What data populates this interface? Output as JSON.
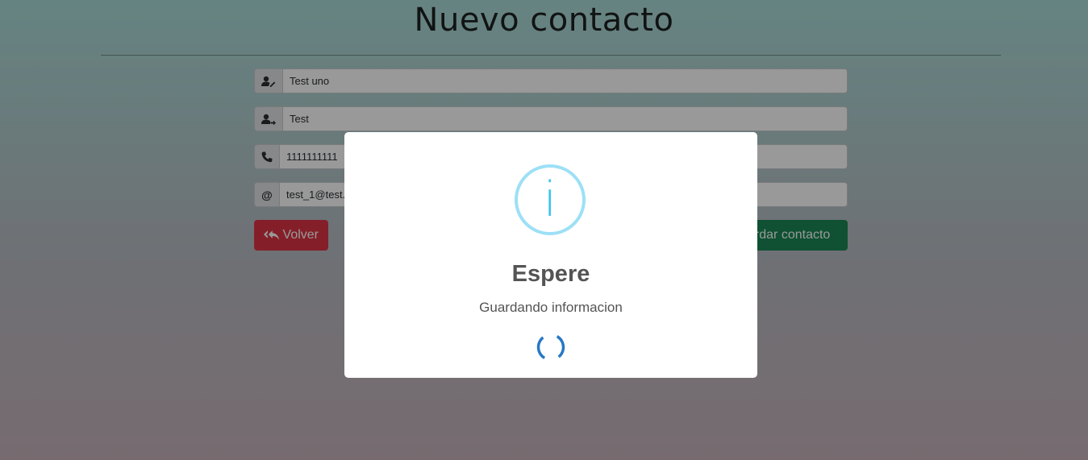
{
  "page": {
    "title": "Nuevo contacto"
  },
  "form": {
    "name": {
      "value": "Test uno",
      "icon": "user-pen-icon"
    },
    "lastname": {
      "value": "Test",
      "icon": "user-arrow-icon"
    },
    "phone": {
      "value": "1111111111",
      "icon": "phone-icon"
    },
    "email": {
      "value": "test_1@test.com",
      "icon": "at-icon",
      "addon": "@"
    }
  },
  "buttons": {
    "back_label": "Volver",
    "save_label": "Guardar contacto"
  },
  "modal": {
    "icon": "info-icon",
    "icon_glyph": "i",
    "title": "Espere",
    "text": "Guardando informacion",
    "loader": "spinner-icon"
  },
  "colors": {
    "danger": "#dc3545",
    "success": "#198754",
    "info": "#3fc3ee",
    "spinner": "#2778c4"
  }
}
